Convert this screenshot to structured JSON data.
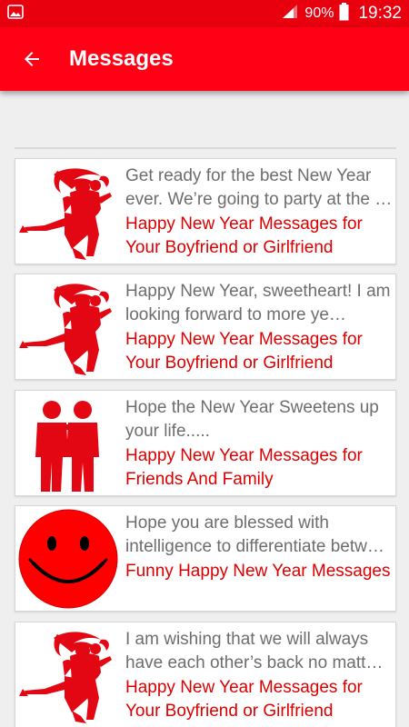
{
  "status_bar": {
    "battery": "90%",
    "time": "19:32",
    "icons": [
      "image-notification-icon",
      "signal-icon",
      "battery-icon"
    ]
  },
  "app_bar": {
    "title": "Messages",
    "back_icon": "arrow-back-icon"
  },
  "colors": {
    "primary": "#ff0014",
    "status_bar": "#e8000f",
    "accent_text": "#dd0000",
    "preview_text": "#6d6d6d",
    "background": "#efefef"
  },
  "messages": [
    {
      "preview": "Get ready for the best New Year ever. We’re going to party at the …",
      "category": "Happy New Year Messages for Your Boyfriend or Girlfriend",
      "image": "couple-silhouette-icon"
    },
    {
      "preview": "Happy New Year, sweetheart! I am looking forward to more ye…",
      "category": "Happy New Year Messages for Your Boyfriend or Girlfriend",
      "image": "couple-silhouette-icon"
    },
    {
      "preview": "Hope the New Year Sweetens up your life.....",
      "category": "Happy New Year Messages for Friends And Family",
      "image": "friends-silhouette-icon"
    },
    {
      "preview": "Hope you are blessed with intelligence to differentiate betw…",
      "category": "Funny Happy New Year Messages",
      "image": "smiley-face-icon"
    },
    {
      "preview": "I am wishing that we will always have each other’s back no matt…",
      "category": "Happy New Year Messages for Your Boyfriend or Girlfriend",
      "image": "couple-silhouette-icon"
    }
  ]
}
